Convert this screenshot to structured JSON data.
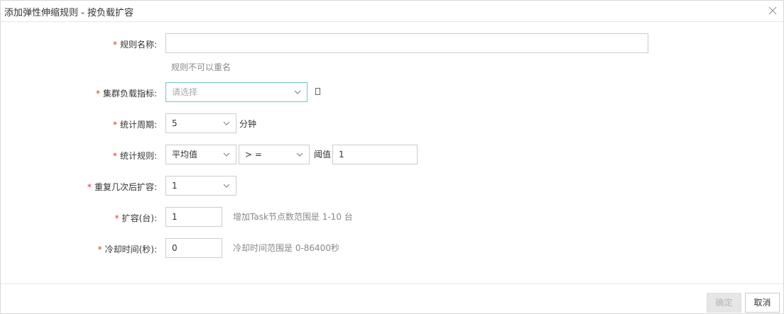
{
  "dialog": {
    "title": "添加弹性伸缩规则 - 按负载扩容",
    "close_icon": "close-icon"
  },
  "form": {
    "rule_name": {
      "label": "规则名称:",
      "value": "",
      "hint": "规则不可以重名"
    },
    "metric": {
      "label": "集群负载指标:",
      "placeholder": "请选择"
    },
    "period": {
      "label": "统计周期:",
      "value": "5",
      "unit": "分钟"
    },
    "stat_rule": {
      "label": "统计规则:",
      "aggregate": "平均值",
      "operator": "> =",
      "threshold_label": "阈值",
      "threshold_value": "1"
    },
    "repeat": {
      "label": "重复几次后扩容:",
      "value": "1"
    },
    "scale": {
      "label": "扩容(台):",
      "value": "1",
      "hint": "增加Task节点数范围是 1-10 台"
    },
    "cooldown": {
      "label": "冷却时间(秒):",
      "value": "0",
      "hint": "冷却时间范围是 0-86400秒"
    }
  },
  "required_mark": "*",
  "footer": {
    "ok_label": "确定",
    "cancel_label": "取消"
  },
  "colors": {
    "required": "#e0352b",
    "focus_border": "#73c7d4",
    "disabled_bg": "#e6e6e6"
  }
}
